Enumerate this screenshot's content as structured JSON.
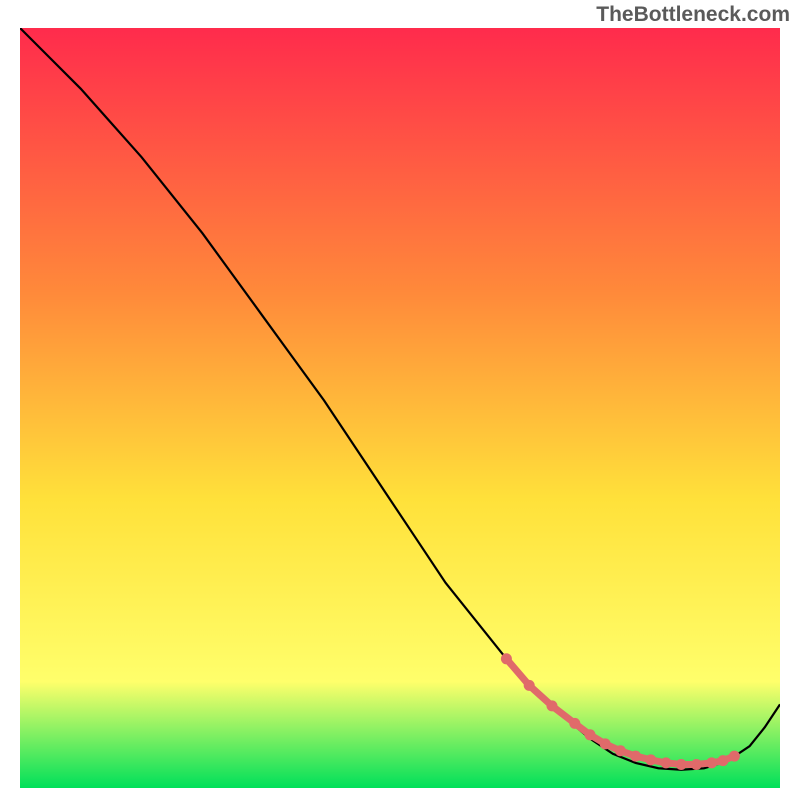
{
  "watermark": "TheBottleneck.com",
  "chart_data": {
    "type": "line",
    "title": "",
    "xlabel": "",
    "ylabel": "",
    "xlim": [
      0,
      100
    ],
    "ylim": [
      0,
      100
    ],
    "background_gradient": {
      "top": "#ff2b4c",
      "mid1": "#ff8a3a",
      "mid2": "#ffe13a",
      "mid3": "#ffff6b",
      "bottom": "#00e05a"
    },
    "series": [
      {
        "name": "curve",
        "stroke": "#000000",
        "x": [
          0,
          4,
          8,
          12,
          16,
          20,
          24,
          28,
          32,
          36,
          40,
          44,
          48,
          52,
          56,
          60,
          64,
          68,
          72,
          75,
          78,
          81,
          84,
          87,
          90,
          93,
          96,
          98,
          100
        ],
        "values": [
          100,
          96,
          92,
          87.5,
          83,
          78,
          73,
          67.5,
          62,
          56.5,
          51,
          45,
          39,
          33,
          27,
          22,
          17,
          12.5,
          9,
          6.5,
          4.5,
          3.3,
          2.6,
          2.4,
          2.6,
          3.5,
          5.5,
          8,
          11
        ]
      }
    ],
    "markers": {
      "name": "bottleneck-dots",
      "stroke": "#e06a6a",
      "fill": "#e06a6a",
      "points_x": [
        64,
        67,
        70,
        73,
        75,
        77,
        79,
        81,
        83,
        85,
        87,
        89,
        91,
        92.5,
        94
      ],
      "points_y": [
        17,
        13.5,
        10.8,
        8.5,
        7,
        5.8,
        4.9,
        4.2,
        3.7,
        3.3,
        3.1,
        3.1,
        3.3,
        3.6,
        4.2
      ]
    }
  }
}
